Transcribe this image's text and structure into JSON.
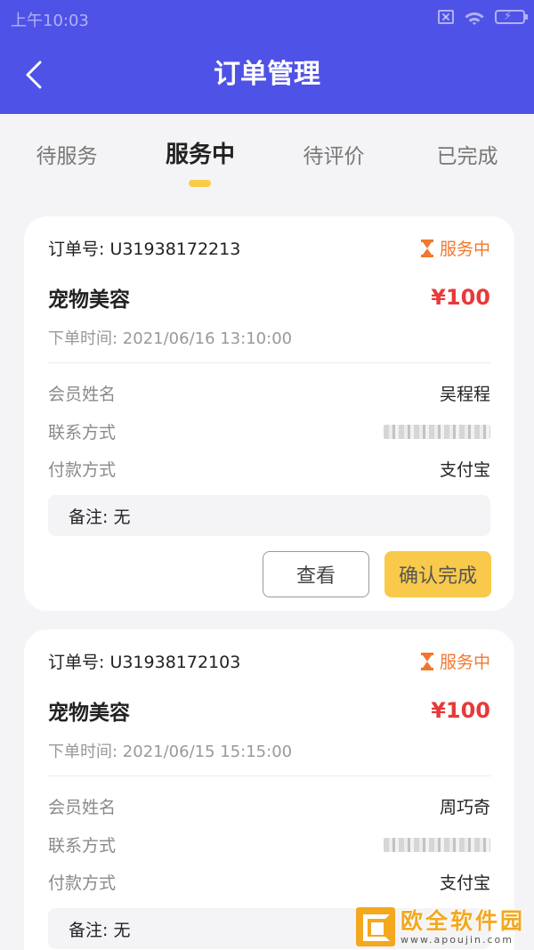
{
  "status_bar": {
    "time": "上午10:03"
  },
  "header": {
    "title": "订单管理"
  },
  "tabs": [
    {
      "label": "待服务",
      "active": false
    },
    {
      "label": "服务中",
      "active": true
    },
    {
      "label": "待评价",
      "active": false
    },
    {
      "label": "已完成",
      "active": false
    }
  ],
  "labels": {
    "order_no_prefix": "订单号:",
    "order_time_prefix": "下单时间:",
    "member_name": "会员姓名",
    "contact": "联系方式",
    "payment": "付款方式",
    "view_button": "查看",
    "confirm_button": "确认完成"
  },
  "orders": [
    {
      "order_no": "订单号: U31938172213",
      "status": "服务中",
      "service": "宠物美容",
      "price": "¥100",
      "order_time": "下单时间: 2021/06/16 13:10:00",
      "member_name": "吴程程",
      "payment_method": "支付宝",
      "remark": "备注: 无"
    },
    {
      "order_no": "订单号: U31938172103",
      "status": "服务中",
      "service": "宠物美容",
      "price": "¥100",
      "order_time": "下单时间: 2021/06/15 15:15:00",
      "member_name": "周巧奇",
      "payment_method": "支付宝",
      "remark": "备注: 无"
    }
  ],
  "watermark": {
    "title": "欧全软件园",
    "url": "www.apoujin.com"
  },
  "colors": {
    "header_bg": "#4f52e6",
    "status_orange": "#f2772e",
    "price_red": "#e8393a",
    "confirm_yellow": "#f8c94a",
    "tab_indicator": "#f8cc47"
  }
}
